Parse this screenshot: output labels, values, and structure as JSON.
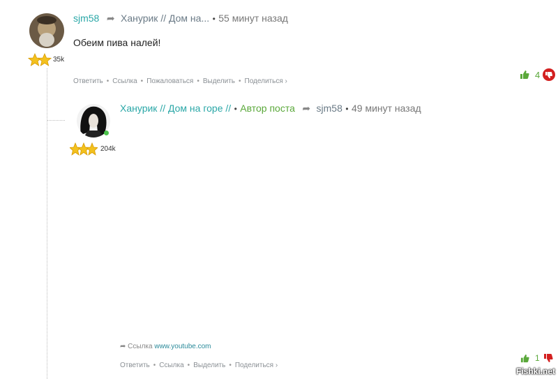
{
  "comments": [
    {
      "username": "sjm58",
      "thread": "Ханурик // Дом на...",
      "time": "55 минут назад",
      "text": "Обеим пива налей!",
      "karma": "35k",
      "votes": "4",
      "actions": [
        "Ответить",
        "Ссылка",
        "Пожаловаться",
        "Выделить",
        "Поделиться ›"
      ]
    },
    {
      "username": "Ханурик // Дом на горе //",
      "badge": "Автор поста",
      "reply_to": "sjm58",
      "time": "49 минут назад",
      "karma": "204k",
      "link_label": "Ссылка",
      "link_url": "www.youtube.com",
      "votes": "1",
      "actions": [
        "Ответить",
        "Ссылка",
        "Выделить",
        "Поделиться ›"
      ]
    }
  ],
  "watermark": "Fishki.net",
  "colors": {
    "username": "#2aa7a7",
    "author_badge": "#5aa83a",
    "vote_up": "#5aa83a",
    "vote_down": "#d32020",
    "online": "#4cc34c"
  }
}
